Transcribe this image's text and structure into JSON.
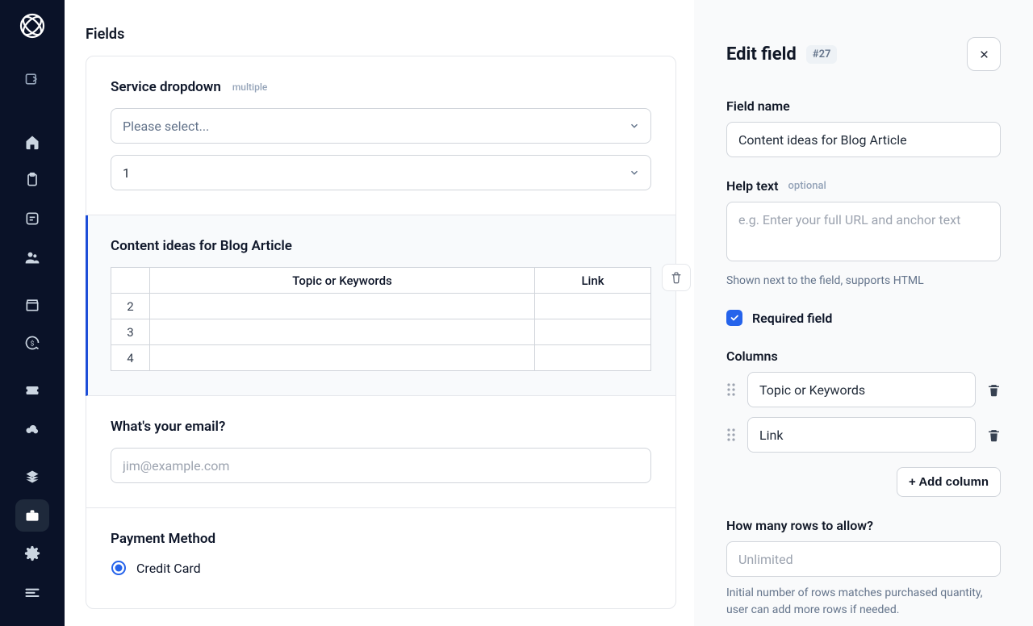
{
  "sidebar": {
    "items": [
      {
        "name": "collapse",
        "icon": "collapse"
      },
      {
        "name": "home",
        "icon": "home"
      },
      {
        "name": "clipboard",
        "icon": "clipboard"
      },
      {
        "name": "note",
        "icon": "note"
      },
      {
        "name": "people",
        "icon": "people"
      },
      {
        "name": "store",
        "icon": "store"
      },
      {
        "name": "refresh-cash",
        "icon": "refresh"
      },
      {
        "name": "ticket",
        "icon": "ticket"
      },
      {
        "name": "cloud",
        "icon": "cloud"
      },
      {
        "name": "layers",
        "icon": "layers"
      },
      {
        "name": "briefcase",
        "icon": "briefcase",
        "active": true
      },
      {
        "name": "settings",
        "icon": "gear"
      },
      {
        "name": "logs",
        "icon": "logs"
      }
    ]
  },
  "main": {
    "title": "Fields",
    "sections": {
      "service": {
        "label": "Service dropdown",
        "tag": "multiple",
        "select1_placeholder": "Please select...",
        "select2_value": "1"
      },
      "content": {
        "label": "Content ideas for Blog Article",
        "col1_header": "Topic or Keywords",
        "col2_header": "Link",
        "rows": [
          "2",
          "3",
          "4"
        ]
      },
      "email": {
        "label": "What's your email?",
        "placeholder": "jim@example.com"
      },
      "payment": {
        "label": "Payment Method",
        "option1": "Credit Card"
      }
    }
  },
  "panel": {
    "title": "Edit field",
    "chip": "#27",
    "field_name": {
      "label": "Field name",
      "value": "Content ideas for Blog Article"
    },
    "help_text": {
      "label": "Help text",
      "optional": "optional",
      "placeholder": "e.g. Enter your full URL and anchor text",
      "hint": "Shown next to the field, supports HTML"
    },
    "required_label": "Required field",
    "columns_label": "Columns",
    "col1_value": "Topic or Keywords",
    "col2_value": "Link",
    "add_column": "+ Add column",
    "rows": {
      "label": "How many rows to allow?",
      "placeholder": "Unlimited",
      "hint": "Initial number of rows matches purchased quantity, user can add more rows if needed."
    }
  }
}
